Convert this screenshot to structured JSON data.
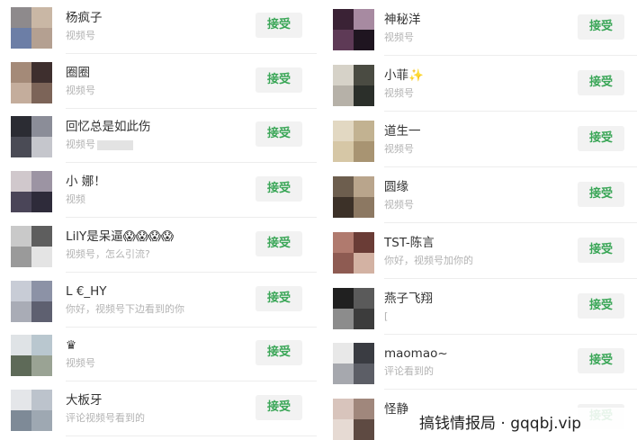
{
  "accept_label": "接受",
  "left_items": [
    {
      "name": "杨疯子",
      "sub": "视频号",
      "blur": false,
      "colors": [
        "#8e8a8c",
        "#c9b7a5",
        "#6c7ea6",
        "#b4a091"
      ]
    },
    {
      "name": "圈圈",
      "sub": "视频号",
      "blur": false,
      "colors": [
        "#a48a78",
        "#3e2f2e",
        "#c4ad9c",
        "#7c6458"
      ]
    },
    {
      "name": "回忆总是如此伤",
      "sub": "视频号",
      "blur": true,
      "colors": [
        "#2b2c33",
        "#8b8d98",
        "#4a4b55",
        "#c5c6cc"
      ]
    },
    {
      "name": "小 娜！",
      "sub": "视频",
      "blur": false,
      "colors": [
        "#d0c8cc",
        "#9c94a3",
        "#4a4558",
        "#2e2b3a"
      ]
    },
    {
      "name": "LilY是呆逼😱😱😱😱",
      "sub": "视频号，怎么引流?",
      "blur": false,
      "colors": [
        "#c9c9c9",
        "#5e5e5e",
        "#9a9a9a",
        "#e4e4e4"
      ]
    },
    {
      "name": "L €_HY",
      "sub": "你好，视频号下边看到的你",
      "blur": false,
      "colors": [
        "#c8ccd6",
        "#8c92a6",
        "#a9acb6",
        "#5e6070"
      ]
    },
    {
      "name": "♛",
      "sub": "视频号",
      "blur": false,
      "colors": [
        "#dfe3e6",
        "#b9c7cf",
        "#5e6a58",
        "#9aa394"
      ]
    },
    {
      "name": "大板牙",
      "sub": "评论视频号看到的",
      "blur": false,
      "colors": [
        "#e4e6e9",
        "#bcc3cc",
        "#7e8a97",
        "#9ea8b2"
      ]
    }
  ],
  "right_items": [
    {
      "name": "神秘洋",
      "sub": "视频号",
      "blur": false,
      "colors": [
        "#3a2235",
        "#a78aa1",
        "#5e3a56",
        "#1f1520"
      ]
    },
    {
      "name": "小菲✨",
      "sub": "视频号",
      "blur": false,
      "colors": [
        "#d6d2c8",
        "#4a4b42",
        "#b6b1a8",
        "#2b2f2a"
      ]
    },
    {
      "name": "道生一",
      "sub": "视频号",
      "blur": false,
      "colors": [
        "#e2d8c2",
        "#c2b291",
        "#d6c7a6",
        "#a89472"
      ]
    },
    {
      "name": "圆缘",
      "sub": "视频号",
      "blur": false,
      "colors": [
        "#6d5e4e",
        "#b9a58c",
        "#3c3128",
        "#8c7862"
      ]
    },
    {
      "name": "TST-陈言",
      "sub": "你好，视频号加你的",
      "blur": false,
      "colors": [
        "#b07a6e",
        "#6a3c36",
        "#8e5b52",
        "#d3b2a3"
      ]
    },
    {
      "name": "燕子飞翔",
      "sub": "[",
      "blur": false,
      "colors": [
        "#202020",
        "#5a5a5a",
        "#8c8c8c",
        "#3c3c3c"
      ]
    },
    {
      "name": "maomao~",
      "sub": "评论看到的",
      "blur": false,
      "colors": [
        "#e8e8e8",
        "#3a3c42",
        "#a6a8ae",
        "#5c5e66"
      ]
    },
    {
      "name": "怪静",
      "sub": "",
      "blur": false,
      "colors": [
        "#d8c4bc",
        "#a0877c",
        "#e6dad3",
        "#5e4a42"
      ]
    }
  ],
  "watermark": "搞钱情报局 · gqqbj.vip"
}
